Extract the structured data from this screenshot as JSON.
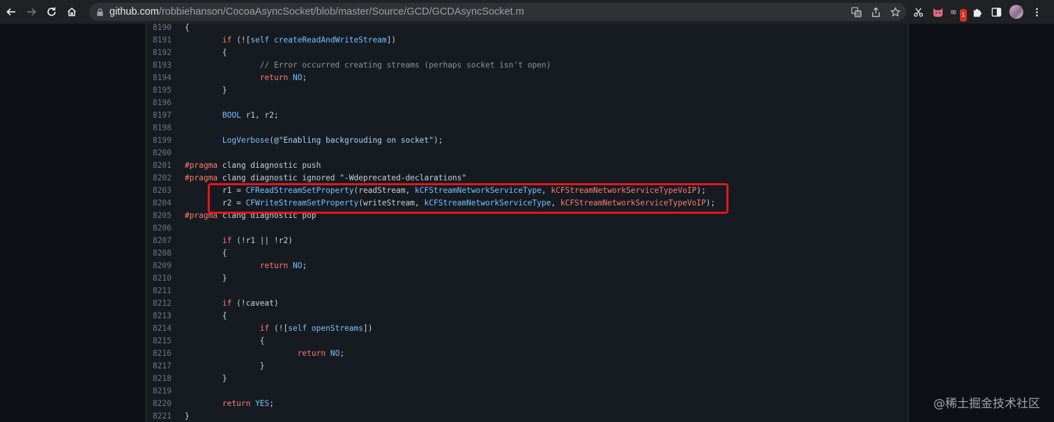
{
  "browser": {
    "url_host": "github.com",
    "url_path": "/robbiehanson/CocoaAsyncSocket/blob/master/Source/GCD/GCDAsyncSocket.m",
    "extension_badge": "1"
  },
  "code": {
    "lines": [
      {
        "n": "8190",
        "tokens": [
          [
            "p",
            "{"
          ]
        ]
      },
      {
        "n": "8191",
        "tokens": [
          [
            "p",
            "        "
          ],
          [
            "kw",
            "if"
          ],
          [
            "p",
            " (!["
          ],
          [
            "fn",
            "self"
          ],
          [
            "p",
            " "
          ],
          [
            "fn",
            "createReadAndWriteStream"
          ],
          [
            "p",
            "])"
          ]
        ]
      },
      {
        "n": "8192",
        "tokens": [
          [
            "p",
            "        {"
          ]
        ]
      },
      {
        "n": "8193",
        "tokens": [
          [
            "p",
            "                "
          ],
          [
            "cm",
            "// Error occurred creating streams (perhaps socket isn't open)"
          ]
        ]
      },
      {
        "n": "8194",
        "tokens": [
          [
            "p",
            "                "
          ],
          [
            "kw",
            "return"
          ],
          [
            "p",
            " "
          ],
          [
            "nm",
            "NO"
          ],
          [
            "p",
            ";"
          ]
        ]
      },
      {
        "n": "8195",
        "tokens": [
          [
            "p",
            "        }"
          ]
        ]
      },
      {
        "n": "8196",
        "tokens": []
      },
      {
        "n": "8197",
        "tokens": [
          [
            "p",
            "        "
          ],
          [
            "fn",
            "BOOL"
          ],
          [
            "p",
            " r1, r2;"
          ]
        ]
      },
      {
        "n": "8198",
        "tokens": []
      },
      {
        "n": "8199",
        "tokens": [
          [
            "p",
            "        "
          ],
          [
            "fn",
            "LogVerbose"
          ],
          [
            "p",
            "("
          ],
          [
            "str",
            "@\"Enabling backgrouding on socket\""
          ],
          [
            "p",
            ");"
          ]
        ]
      },
      {
        "n": "8200",
        "tokens": []
      },
      {
        "n": "8201",
        "tokens": [
          [
            "kw",
            "#pragma"
          ],
          [
            "p",
            " clang diagnostic push"
          ]
        ]
      },
      {
        "n": "8202",
        "tokens": [
          [
            "kw",
            "#pragma"
          ],
          [
            "p",
            " clang diagnostic ignored \"-Wdeprecated-declarations\""
          ]
        ]
      },
      {
        "n": "8203",
        "tokens": [
          [
            "p",
            "        r1 = "
          ],
          [
            "fn",
            "CFReadStreamSetProperty"
          ],
          [
            "p",
            "(readStream, "
          ],
          [
            "fn",
            "kCFStreamNetworkServiceType"
          ],
          [
            "p",
            ", "
          ],
          [
            "cst",
            "kCFStreamNetworkServiceTypeVoIP"
          ],
          [
            "p",
            ");"
          ]
        ]
      },
      {
        "n": "8204",
        "tokens": [
          [
            "p",
            "        r2 = "
          ],
          [
            "fn",
            "CFWriteStreamSetProperty"
          ],
          [
            "p",
            "(writeStream, "
          ],
          [
            "fn",
            "kCFStreamNetworkServiceType"
          ],
          [
            "p",
            ", "
          ],
          [
            "cst",
            "kCFStreamNetworkServiceTypeVoIP"
          ],
          [
            "p",
            ");"
          ]
        ]
      },
      {
        "n": "8205",
        "tokens": [
          [
            "kw",
            "#pragma"
          ],
          [
            "p",
            " clang diagnostic pop"
          ]
        ]
      },
      {
        "n": "8206",
        "tokens": []
      },
      {
        "n": "8207",
        "tokens": [
          [
            "p",
            "        "
          ],
          [
            "kw",
            "if"
          ],
          [
            "p",
            " (!r1 || !r2)"
          ]
        ]
      },
      {
        "n": "8208",
        "tokens": [
          [
            "p",
            "        {"
          ]
        ]
      },
      {
        "n": "8209",
        "tokens": [
          [
            "p",
            "                "
          ],
          [
            "kw",
            "return"
          ],
          [
            "p",
            " "
          ],
          [
            "nm",
            "NO"
          ],
          [
            "p",
            ";"
          ]
        ]
      },
      {
        "n": "8210",
        "tokens": [
          [
            "p",
            "        }"
          ]
        ]
      },
      {
        "n": "8211",
        "tokens": []
      },
      {
        "n": "8212",
        "tokens": [
          [
            "p",
            "        "
          ],
          [
            "kw",
            "if"
          ],
          [
            "p",
            " (!caveat)"
          ]
        ]
      },
      {
        "n": "8213",
        "tokens": [
          [
            "p",
            "        {"
          ]
        ]
      },
      {
        "n": "8214",
        "tokens": [
          [
            "p",
            "                "
          ],
          [
            "kw",
            "if"
          ],
          [
            "p",
            " (!["
          ],
          [
            "fn",
            "self"
          ],
          [
            "p",
            " "
          ],
          [
            "fn",
            "openStreams"
          ],
          [
            "p",
            "])"
          ]
        ]
      },
      {
        "n": "8215",
        "tokens": [
          [
            "p",
            "                {"
          ]
        ]
      },
      {
        "n": "8216",
        "tokens": [
          [
            "p",
            "                        "
          ],
          [
            "kw",
            "return"
          ],
          [
            "p",
            " "
          ],
          [
            "nm",
            "NO"
          ],
          [
            "p",
            ";"
          ]
        ]
      },
      {
        "n": "8217",
        "tokens": [
          [
            "p",
            "                }"
          ]
        ]
      },
      {
        "n": "8218",
        "tokens": [
          [
            "p",
            "        }"
          ]
        ]
      },
      {
        "n": "8219",
        "tokens": []
      },
      {
        "n": "8220",
        "tokens": [
          [
            "p",
            "        "
          ],
          [
            "kw",
            "return"
          ],
          [
            "p",
            " "
          ],
          [
            "nm",
            "YES"
          ],
          [
            "p",
            ";"
          ]
        ]
      },
      {
        "n": "8221",
        "tokens": [
          [
            "p",
            "}"
          ]
        ]
      }
    ]
  },
  "watermark": "@稀土掘金技术社区",
  "colors": {
    "highlight_border": "#e5171b",
    "keyword": "#ff7b72",
    "function": "#79c0ff",
    "string": "#a5d6ff",
    "comment": "#8b949e"
  }
}
